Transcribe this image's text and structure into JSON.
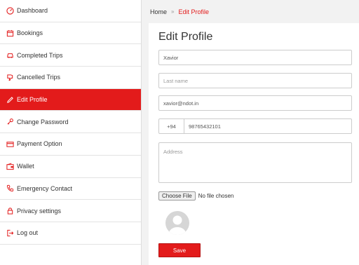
{
  "sidebar": {
    "items": [
      {
        "label": "Dashboard",
        "icon": "dashboard-icon"
      },
      {
        "label": "Bookings",
        "icon": "calendar-icon"
      },
      {
        "label": "Completed Trips",
        "icon": "car-icon"
      },
      {
        "label": "Cancelled Trips",
        "icon": "thumbs-down-icon"
      },
      {
        "label": "Edit Profile",
        "icon": "pencil-icon",
        "active": true
      },
      {
        "label": "Change Password",
        "icon": "key-icon"
      },
      {
        "label": "Payment Option",
        "icon": "credit-card-icon"
      },
      {
        "label": "Wallet",
        "icon": "wallet-icon"
      },
      {
        "label": "Emergency Contact",
        "icon": "phone-icon"
      },
      {
        "label": "Privacy settings",
        "icon": "lock-icon"
      },
      {
        "label": "Log out",
        "icon": "logout-icon"
      }
    ]
  },
  "breadcrumb": {
    "home": "Home",
    "separator": "»",
    "current": "Edit Profile"
  },
  "form": {
    "title": "Edit Profile",
    "first_name": "Xavior",
    "last_name_placeholder": "Last name",
    "email": "xavior@ndot.in",
    "country_code": "+94",
    "phone": "98765432101",
    "address_placeholder": "Address",
    "file_button": "Choose File",
    "file_status": "No file chosen",
    "save_label": "Save"
  },
  "colors": {
    "accent": "#e31b1b"
  }
}
